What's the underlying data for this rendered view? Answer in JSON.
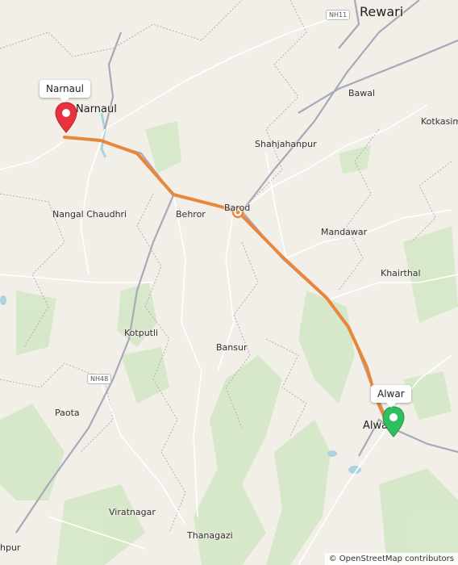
{
  "places": {
    "rewari": "Rewari",
    "narnaul": "Narnaul",
    "bawal": "Bawal",
    "kotkasim": "Kotkasim",
    "shahjahanpur": "Shahjahanpur",
    "behror": "Behror",
    "barod": "Barod",
    "nangal_chaudhri": "Nangal Chaudhri",
    "mandawar": "Mandawar",
    "khairthal": "Khairthal",
    "kotputli": "Kotputli",
    "bansur": "Bansur",
    "paota": "Paota",
    "alwar": "Alwar",
    "viratnagar": "Viratnagar",
    "thanagazi": "Thanagazi",
    "jaipur_partial": "hpur"
  },
  "highways": {
    "nh11": "NH11",
    "nh48": "NH48"
  },
  "route": {
    "start_label": "Narnaul",
    "end_label": "Alwar",
    "color": "#e8873a",
    "start_pin_color": "#e8333f",
    "end_pin_color": "#2ec05e"
  },
  "attribution": "© OpenStreetMap contributors"
}
